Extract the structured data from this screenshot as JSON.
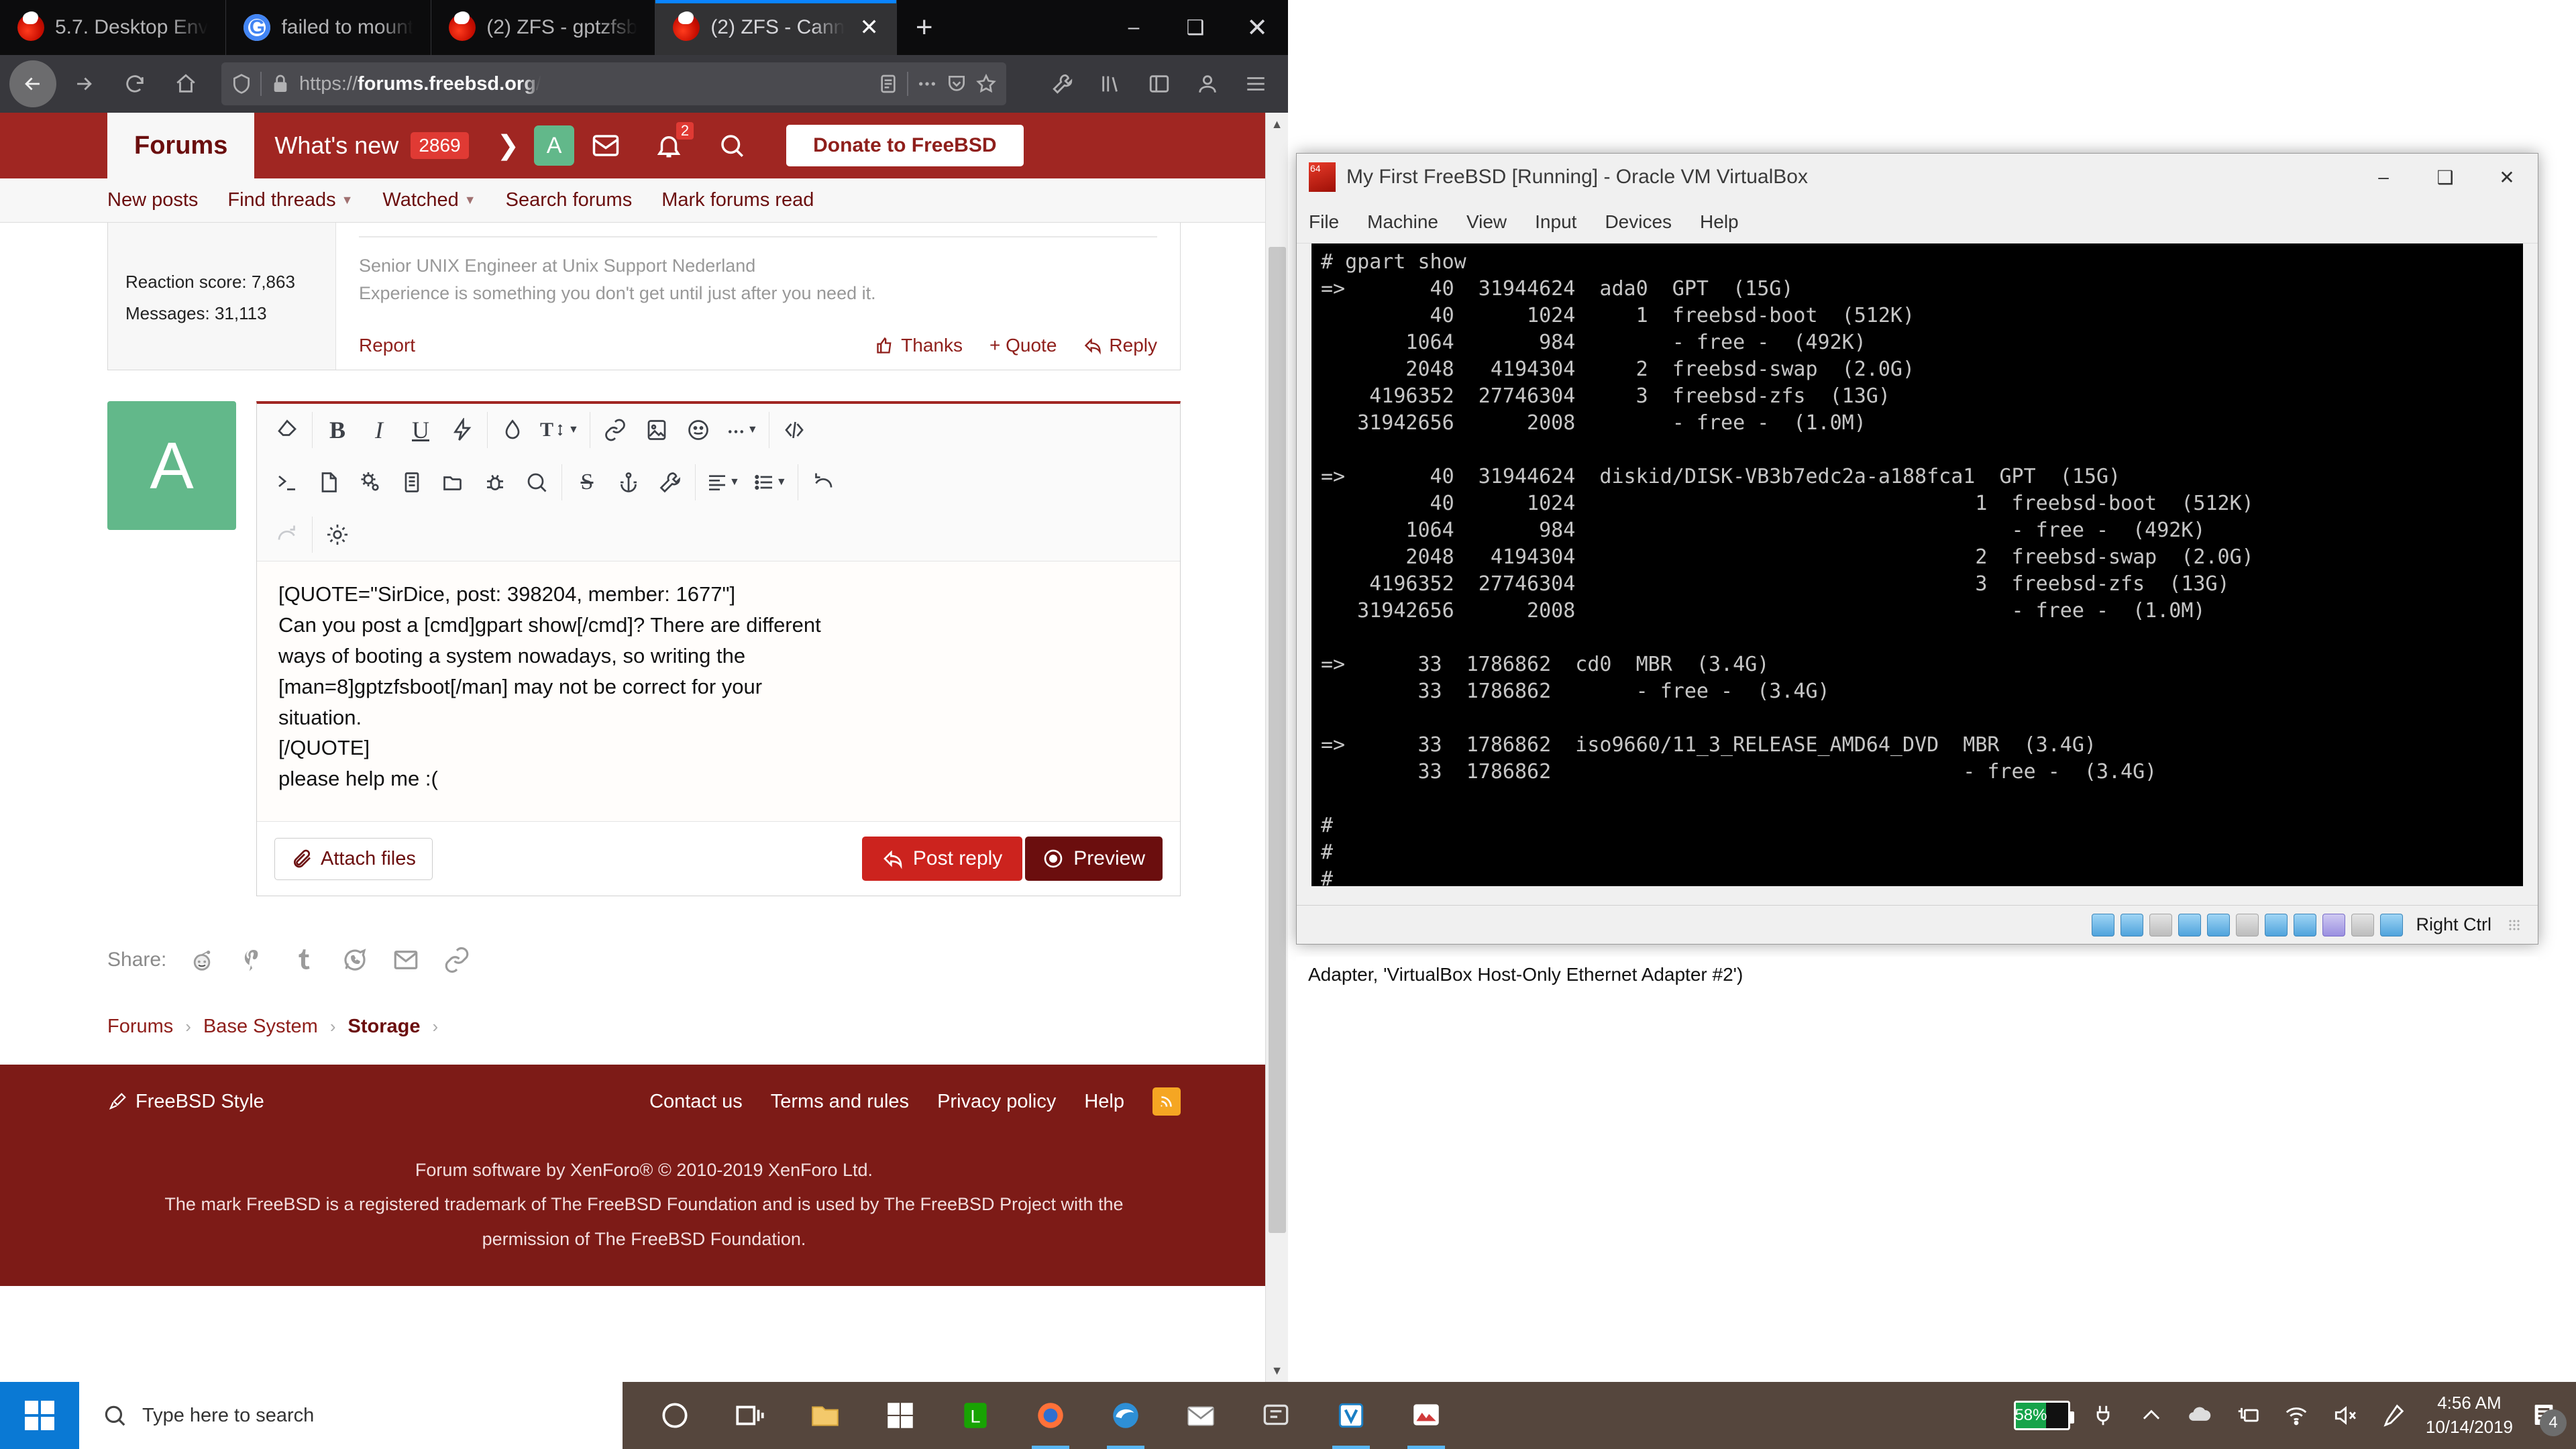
{
  "browser": {
    "tabs": [
      {
        "title": "5.7. Desktop Env",
        "favicon": "freebsd-icon",
        "active": false
      },
      {
        "title": "failed to mount",
        "favicon": "google-icon",
        "active": false
      },
      {
        "title": "(2) ZFS - gptzfsb",
        "favicon": "freebsd-icon",
        "active": false
      },
      {
        "title": "(2) ZFS - Cann",
        "favicon": "freebsd-icon",
        "active": true
      }
    ],
    "newtab_label": "+",
    "window_controls": {
      "minimize": "–",
      "maximize": "❑",
      "close": "✕"
    },
    "url_prefix": "https://",
    "url_bold": "forums.freebsd.org",
    "url_suffix": "/",
    "nav": {
      "back": "back-arrow",
      "forward": "forward-arrow",
      "reload": "reload-icon",
      "home": "home-icon"
    }
  },
  "forum": {
    "logo": "Forums",
    "whats_new_label": "What's new",
    "whats_new_count": "2869",
    "avatar_letter": "A",
    "alerts_count": "2",
    "donate_label": "Donate to FreeBSD",
    "subnav": [
      {
        "label": "New posts",
        "caret": false
      },
      {
        "label": "Find threads",
        "caret": true
      },
      {
        "label": "Watched",
        "caret": true
      },
      {
        "label": "Search forums",
        "caret": false
      },
      {
        "label": "Mark forums read",
        "caret": false
      }
    ],
    "post": {
      "stats": [
        {
          "label": "Reaction score: 7,863"
        },
        {
          "label": "Messages: 31,113"
        }
      ],
      "signature_line1": "Senior UNIX Engineer at Unix Support Nederland",
      "signature_line2": "Experience is something you don't get until just after you need it.",
      "report_label": "Report",
      "thanks_label": "Thanks",
      "quote_label": "+ Quote",
      "reply_label": "Reply"
    },
    "editor": {
      "avatar_letter": "A",
      "toolbar_row1": [
        {
          "name": "remove-formatting-icon",
          "glyph": "eraser"
        },
        {
          "name": "bold-icon",
          "glyph": "B"
        },
        {
          "name": "italic-icon",
          "glyph": "I"
        },
        {
          "name": "underline-icon",
          "glyph": "U"
        },
        {
          "name": "strike-lightning-icon",
          "glyph": "bolt"
        },
        {
          "name": "text-color-icon",
          "glyph": "drop"
        },
        {
          "name": "font-size-icon",
          "glyph": "TT"
        },
        {
          "name": "insert-link-icon",
          "glyph": "link"
        },
        {
          "name": "insert-image-icon",
          "glyph": "image"
        },
        {
          "name": "smilies-icon",
          "glyph": "smile"
        },
        {
          "name": "more-options-icon",
          "glyph": "dots"
        },
        {
          "name": "toggle-bbcode-icon",
          "glyph": "code"
        }
      ],
      "toolbar_row2": [
        {
          "name": "inline-code-icon",
          "glyph": "prompt"
        },
        {
          "name": "code-block-icon",
          "glyph": "file"
        },
        {
          "name": "config-icon",
          "glyph": "gears"
        },
        {
          "name": "article-icon",
          "glyph": "article"
        },
        {
          "name": "folder-icon",
          "glyph": "folder"
        },
        {
          "name": "bug-icon",
          "glyph": "bug"
        },
        {
          "name": "quote-bubble-icon",
          "glyph": "bubble"
        },
        {
          "name": "strikethrough-icon",
          "glyph": "S"
        },
        {
          "name": "anchor-icon",
          "glyph": "anchor"
        },
        {
          "name": "wrench-icon",
          "glyph": "wrench"
        },
        {
          "name": "align-icon",
          "glyph": "align"
        },
        {
          "name": "list-icon",
          "glyph": "list"
        },
        {
          "name": "undo-icon",
          "glyph": "undo"
        }
      ],
      "toolbar_row3": [
        {
          "name": "redo-icon",
          "glyph": "redo"
        },
        {
          "name": "editor-settings-icon",
          "glyph": "gear"
        }
      ],
      "content_lines": [
        "[QUOTE=\"SirDice, post: 398204, member: 1677\"]",
        "Can you post a [cmd]gpart show[/cmd]? There are different",
        "ways of booting a system nowadays, so writing the",
        "[man=8]gptzfsboot[/man] may not be correct for your",
        "situation.",
        "[/QUOTE]",
        "please help me :("
      ],
      "attach_label": "Attach files",
      "post_reply_label": "Post reply",
      "preview_label": "Preview"
    },
    "share": {
      "label": "Share:",
      "icons": [
        "reddit-icon",
        "pinterest-icon",
        "tumblr-icon",
        "whatsapp-icon",
        "email-icon",
        "link-icon"
      ]
    },
    "breadcrumbs": [
      {
        "label": "Forums",
        "current": false
      },
      {
        "label": "Base System",
        "current": false
      },
      {
        "label": "Storage",
        "current": true
      }
    ],
    "footer": {
      "style_label": "FreeBSD Style",
      "links": [
        "Contact us",
        "Terms and rules",
        "Privacy policy",
        "Help"
      ],
      "rss": "rss-icon",
      "copyright": "Forum software by XenForo® © 2010-2019 XenForo Ltd.",
      "trademark_line1": "The mark FreeBSD is a registered trademark of The FreeBSD Foundation and is used by The FreeBSD Project with the",
      "trademark_line2": "permission of The FreeBSD Foundation."
    }
  },
  "virtualbox": {
    "title": "My First FreeBSD [Running] - Oracle VM VirtualBox",
    "window_controls": {
      "minimize": "–",
      "maximize": "❑",
      "close": "✕"
    },
    "menu": [
      "File",
      "Machine",
      "View",
      "Input",
      "Devices",
      "Help"
    ],
    "terminal": "# gpart show\n=>       40  31944624  ada0  GPT  (15G)\n         40      1024     1  freebsd-boot  (512K)\n       1064       984        - free -  (492K)\n       2048   4194304     2  freebsd-swap  (2.0G)\n    4196352  27746304     3  freebsd-zfs  (13G)\n   31942656      2008        - free -  (1.0M)\n\n=>       40  31944624  diskid/DISK-VB3b7edc2a-a188fca1  GPT  (15G)\n         40      1024                                 1  freebsd-boot  (512K)\n       1064       984                                    - free -  (492K)\n       2048   4194304                                 2  freebsd-swap  (2.0G)\n    4196352  27746304                                 3  freebsd-zfs  (13G)\n   31942656      2008                                    - free -  (1.0M)\n\n=>      33  1786862  cd0  MBR  (3.4G)\n        33  1786862       - free -  (3.4G)\n\n=>      33  1786862  iso9660/11_3_RELEASE_AMD64_DVD  MBR  (3.4G)\n        33  1786862                                  - free -  (3.4G)\n\n#\n#\n#\n# ",
    "status_icons": [
      "hard-disk-icon",
      "optical-disk-icon",
      "floppy-icon",
      "network-icon",
      "usb-icon",
      "shared-folder-icon",
      "display-icon",
      "recording-icon",
      "virtualization-icon",
      "mouse-icon",
      "host-key-icon"
    ],
    "host_key_label": "Right Ctrl",
    "adapter_note": "Adapter, 'VirtualBox Host-Only Ethernet Adapter #2')"
  },
  "taskbar": {
    "search_placeholder": "Type here to search",
    "items": [
      {
        "name": "cortana-icon"
      },
      {
        "name": "task-view-icon"
      },
      {
        "name": "file-explorer-icon"
      },
      {
        "name": "microsoft-store-icon"
      },
      {
        "name": "libreoffice-icon"
      },
      {
        "name": "firefox-icon",
        "active": true
      },
      {
        "name": "edge-icon",
        "active": true
      },
      {
        "name": "mail-icon"
      },
      {
        "name": "settings-icon"
      },
      {
        "name": "virtualbox-icon",
        "active": true
      },
      {
        "name": "snip-sketch-icon",
        "active": true
      }
    ],
    "tray": {
      "battery_percent": "58%",
      "battery_fill": 58,
      "plug": "plug-icon",
      "show_hidden": "chevron-up-icon",
      "onedrive": "onedrive-icon",
      "device": "device-icon",
      "wifi": "wifi-icon",
      "volume": "volume-muted-icon",
      "pen": "pen-icon",
      "time": "4:56 AM",
      "date": "10/14/2019",
      "notification_count": "4"
    }
  },
  "colors": {
    "brand_red": "#a02622",
    "footer_red": "#7d1b17",
    "post_red": "#cc231e",
    "preview_red": "#6b0e0e",
    "accent_blue": "#0a84ff",
    "battery_green": "#16a34a"
  }
}
